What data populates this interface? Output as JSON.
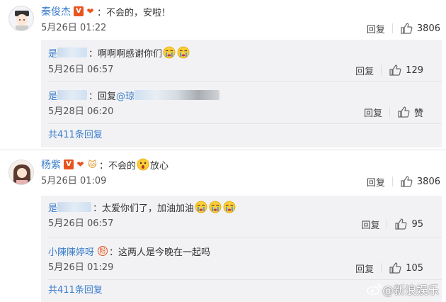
{
  "threads": [
    {
      "username": "秦俊杰",
      "text": "不会的，安啦！",
      "time": "5月26日 01:22",
      "reply_label": "回复",
      "likes": "3806",
      "replies": [
        {
          "username": "是",
          "text": "啊啊啊感谢你们",
          "time": "5月26日 06:57",
          "reply_label": "回复",
          "likes": "129"
        },
        {
          "username": "是",
          "text": "回复",
          "mention": "@琼",
          "time": "5月28日 06:20",
          "reply_label": "回复",
          "likes": "赞"
        }
      ],
      "more_label": "共411条回复"
    },
    {
      "username": "杨紫",
      "text_before": "不会的",
      "text_after": "放心",
      "time": "5月26日 01:09",
      "reply_label": "回复",
      "likes": "3806",
      "replies": [
        {
          "username": "是",
          "text": "太爱你们了，加油加油",
          "time": "5月26日 06:57",
          "reply_label": "回复",
          "likes": "95"
        },
        {
          "username": "小陳陳婷呀",
          "text": "这两人是今晚在一起吗",
          "time": "5月26日 01:29",
          "reply_label": "回复",
          "likes": "105"
        }
      ],
      "more_label": "共411条回复"
    }
  ],
  "colon": "：",
  "watermark": "@新浪娱乐",
  "colors": {
    "link": "#3b7ec9",
    "badge": "#e8541e",
    "subbox": "#f2f2f5"
  },
  "icons": [
    "thumb-up-icon",
    "crying-emoji-icon",
    "shocked-emoji-icon",
    "verified-badge-icon",
    "fan-badge-icon",
    "weibo-logo-icon"
  ]
}
